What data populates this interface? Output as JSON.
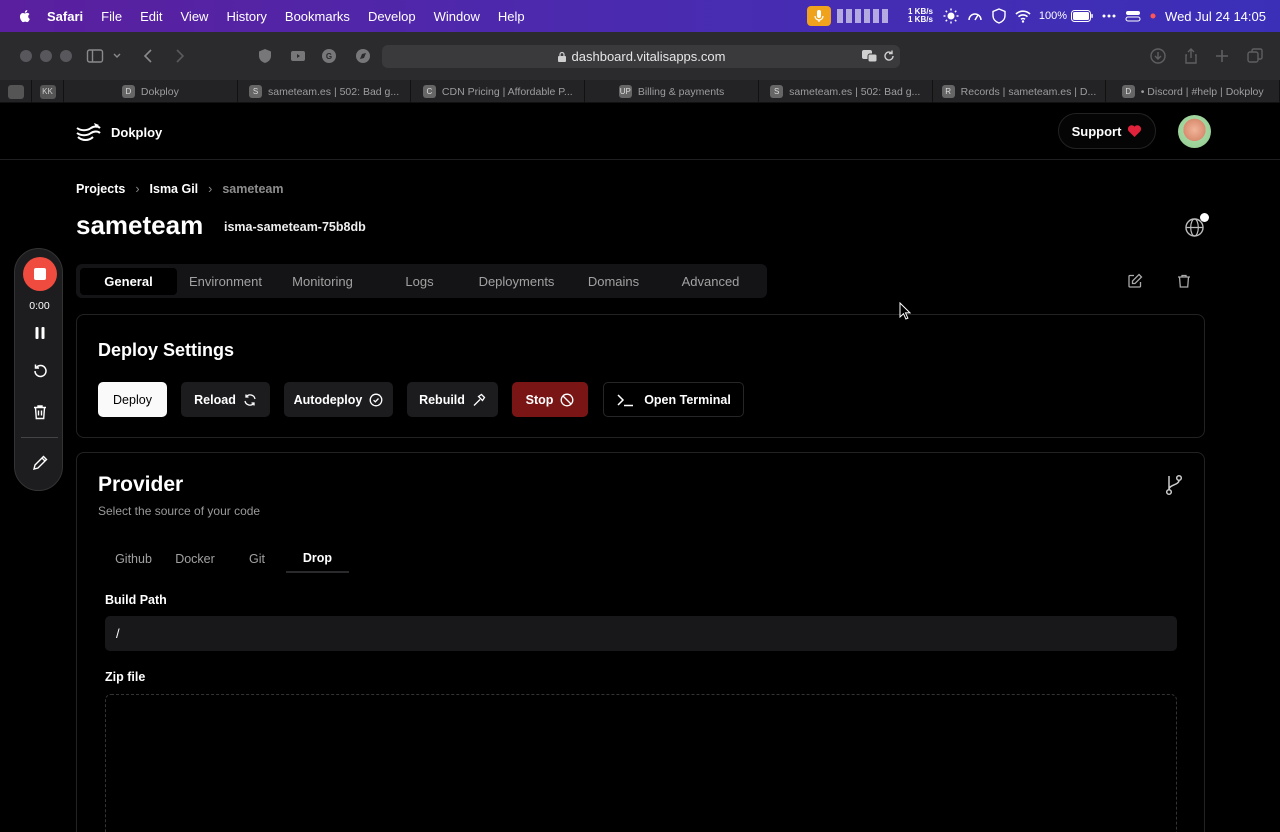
{
  "menubar": {
    "app": "Safari",
    "items": [
      "File",
      "Edit",
      "View",
      "History",
      "Bookmarks",
      "Develop",
      "Window",
      "Help"
    ],
    "net_up": "1 KB/s",
    "net_down": "1 KB/s",
    "battery": "100%",
    "datetime": "Wed Jul 24  14:05"
  },
  "browser": {
    "url": "dashboard.vitalisapps.com",
    "pinned_tab_label": "KK",
    "tabs": [
      {
        "fav": "D",
        "title": "Dokploy"
      },
      {
        "fav": "S",
        "title": "sameteam.es | 502: Bad g..."
      },
      {
        "fav": "C",
        "title": "CDN Pricing | Affordable P..."
      },
      {
        "fav": "UP",
        "title": "Billing & payments"
      },
      {
        "fav": "S",
        "title": "sameteam.es | 502: Bad g..."
      },
      {
        "fav": "R",
        "title": "Records | sameteam.es | D..."
      },
      {
        "fav": "D",
        "title": "• Discord | #help | Dokploy"
      }
    ]
  },
  "header": {
    "brand": "Dokploy",
    "support_label": "Support"
  },
  "breadcrumb": {
    "items": [
      "Projects",
      "Isma Gil",
      "sameteam"
    ]
  },
  "page": {
    "title": "sameteam",
    "app_name": "isma-sameteam-75b8db"
  },
  "tabs": [
    "General",
    "Environment",
    "Monitoring",
    "Logs",
    "Deployments",
    "Domains",
    "Advanced"
  ],
  "deploy_settings": {
    "title": "Deploy Settings",
    "buttons": {
      "deploy": "Deploy",
      "reload": "Reload",
      "autodeploy": "Autodeploy",
      "rebuild": "Rebuild",
      "stop": "Stop",
      "terminal": "Open Terminal"
    }
  },
  "provider": {
    "title": "Provider",
    "subtitle": "Select the source of your code",
    "tabs": [
      "Github",
      "Docker",
      "Git",
      "Drop"
    ],
    "active_tab": "Drop",
    "build_path_label": "Build Path",
    "build_path_value": "/",
    "zip_label": "Zip file"
  },
  "recorder": {
    "time": "0:00"
  },
  "colors": {
    "accent_stop": "#7a1515",
    "recorder_red": "#ef4b3f",
    "menubar": "#4a2bb0"
  }
}
